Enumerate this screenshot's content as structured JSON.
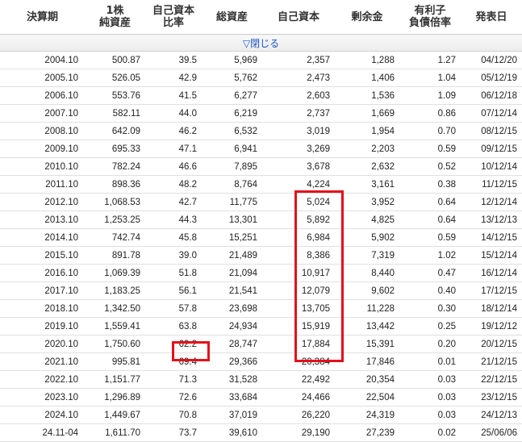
{
  "headers": [
    "決算期",
    "1株\n純資産",
    "自己資本\n比率",
    "総資産",
    "自己資本",
    "剰余金",
    "有利子\n負債倍率",
    "発表日"
  ],
  "toggle_label": "▽閉じる",
  "rows": [
    [
      "2004.10",
      "500.87",
      "39.5",
      "5,969",
      "2,357",
      "1,288",
      "1.27",
      "04/12/20"
    ],
    [
      "2005.10",
      "526.05",
      "42.9",
      "5,762",
      "2,473",
      "1,406",
      "1.04",
      "05/12/19"
    ],
    [
      "2006.10",
      "553.76",
      "41.5",
      "6,277",
      "2,603",
      "1,536",
      "1.09",
      "06/12/18"
    ],
    [
      "2007.10",
      "582.11",
      "44.0",
      "6,219",
      "2,737",
      "1,669",
      "0.86",
      "07/12/14"
    ],
    [
      "2008.10",
      "642.09",
      "46.2",
      "6,532",
      "3,019",
      "1,954",
      "0.70",
      "08/12/15"
    ],
    [
      "2009.10",
      "695.33",
      "47.1",
      "6,941",
      "3,269",
      "2,203",
      "0.59",
      "09/12/15"
    ],
    [
      "2010.10",
      "782.24",
      "46.6",
      "7,895",
      "3,678",
      "2,632",
      "0.52",
      "10/12/14"
    ],
    [
      "2011.10",
      "898.36",
      "48.2",
      "8,764",
      "4,224",
      "3,161",
      "0.38",
      "11/12/15"
    ],
    [
      "2012.10",
      "1,068.53",
      "42.7",
      "11,775",
      "5,024",
      "3,952",
      "0.64",
      "12/12/14"
    ],
    [
      "2013.10",
      "1,253.25",
      "44.3",
      "13,301",
      "5,892",
      "4,825",
      "0.64",
      "13/12/13"
    ],
    [
      "2014.10",
      "742.74",
      "45.8",
      "15,251",
      "6,984",
      "5,902",
      "0.59",
      "14/12/15"
    ],
    [
      "2015.10",
      "891.78",
      "39.0",
      "21,489",
      "8,386",
      "7,319",
      "1.02",
      "15/12/14"
    ],
    [
      "2016.10",
      "1,069.39",
      "51.8",
      "21,094",
      "10,917",
      "8,440",
      "0.47",
      "16/12/14"
    ],
    [
      "2017.10",
      "1,183.25",
      "56.1",
      "21,541",
      "12,079",
      "9,602",
      "0.40",
      "17/12/15"
    ],
    [
      "2018.10",
      "1,342.50",
      "57.8",
      "23,698",
      "13,705",
      "11,228",
      "0.30",
      "18/12/14"
    ],
    [
      "2019.10",
      "1,559.41",
      "63.8",
      "24,934",
      "15,919",
      "13,442",
      "0.25",
      "19/12/12"
    ],
    [
      "2020.10",
      "1,750.60",
      "62.2",
      "28,747",
      "17,884",
      "15,391",
      "0.20",
      "20/12/15"
    ],
    [
      "2021.10",
      "995.81",
      "69.4",
      "29,366",
      "20,384",
      "17,846",
      "0.01",
      "21/12/15"
    ],
    [
      "2022.10",
      "1,151.77",
      "71.3",
      "31,528",
      "22,492",
      "20,354",
      "0.03",
      "22/12/15"
    ],
    [
      "2023.10",
      "1,296.89",
      "72.6",
      "33,684",
      "24,466",
      "22,504",
      "0.03",
      "23/12/15"
    ],
    [
      "2024.10",
      "1,449.67",
      "70.8",
      "37,019",
      "26,220",
      "24,319",
      "0.03",
      "24/12/13"
    ],
    [
      "24.11-04",
      "1,611.70",
      "73.7",
      "39,610",
      "29,190",
      "27,239",
      "0.02",
      "25/06/06"
    ]
  ],
  "highlight_color": "#e3101a",
  "link_color": "#1a56c4"
}
